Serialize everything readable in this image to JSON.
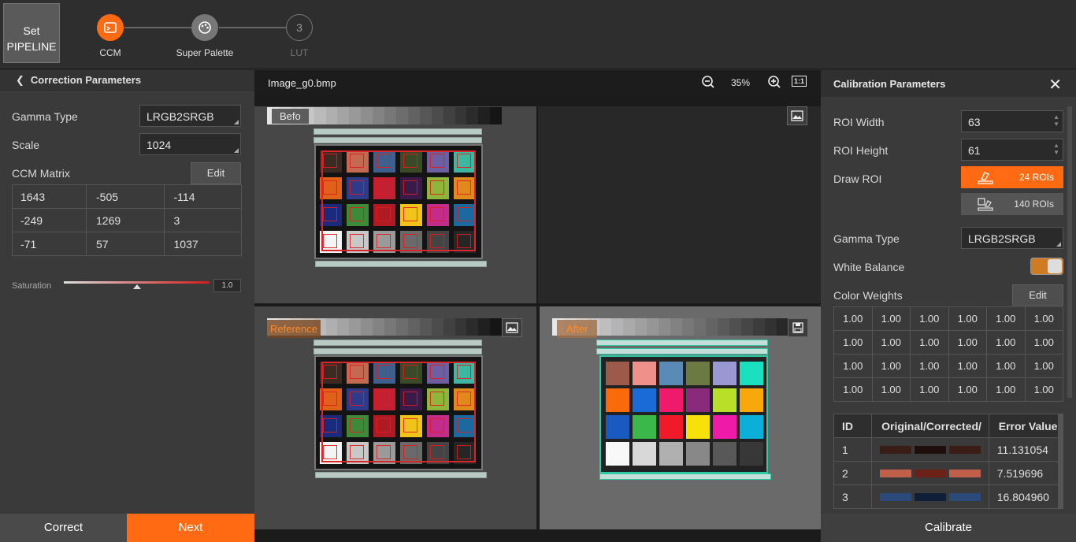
{
  "topbar": {
    "set_pipeline": "Set PIPELINE",
    "steps": [
      {
        "label": "CCM",
        "num": ""
      },
      {
        "label": "Super Palette",
        "num": ""
      },
      {
        "label": "LUT",
        "num": "3"
      }
    ]
  },
  "left": {
    "title": "Correction Parameters",
    "gamma_label": "Gamma Type",
    "gamma_value": "LRGB2SRGB",
    "scale_label": "Scale",
    "scale_value": "1024",
    "ccm_label": "CCM Matrix",
    "edit_label": "Edit",
    "ccm": [
      [
        "1643",
        "-505",
        "-114"
      ],
      [
        "-249",
        "1269",
        "3"
      ],
      [
        "-71",
        "57",
        "1037"
      ]
    ],
    "saturation_label": "Saturation",
    "saturation_value": "1.0",
    "saturation_level": 0.5,
    "correct_label": "Correct",
    "next_label": "Next"
  },
  "image": {
    "filename": "Image_g0.bmp",
    "zoom": "35%",
    "one_to_one": "1:1",
    "before_label": "Befo",
    "reference_label": "Reference",
    "after_label": "After"
  },
  "right": {
    "title": "Calibration Parameters",
    "roi_width_label": "ROI Width",
    "roi_width": "63",
    "roi_height_label": "ROI Height",
    "roi_height": "61",
    "draw_roi_label": "Draw ROI",
    "roi24": "24 ROIs",
    "roi140": "140 ROIs",
    "gamma_label": "Gamma Type",
    "gamma_value": "LRGB2SRGB",
    "wb_label": "White Balance",
    "weights_label": "Color Weights",
    "edit_label": "Edit",
    "weights": [
      [
        "1.00",
        "1.00",
        "1.00",
        "1.00",
        "1.00",
        "1.00"
      ],
      [
        "1.00",
        "1.00",
        "1.00",
        "1.00",
        "1.00",
        "1.00"
      ],
      [
        "1.00",
        "1.00",
        "1.00",
        "1.00",
        "1.00",
        "1.00"
      ],
      [
        "1.00",
        "1.00",
        "1.00",
        "1.00",
        "1.00",
        "1.00"
      ]
    ],
    "result_headers": [
      "ID",
      "Original/Corrected/",
      "Error Value"
    ],
    "results": [
      {
        "id": "1",
        "colors": [
          "#3a1d17",
          "#1e0e0c",
          "#3a1d17"
        ],
        "error": "11.131054"
      },
      {
        "id": "2",
        "colors": [
          "#c0604a",
          "#6b2118",
          "#c0604a"
        ],
        "error": "7.519696"
      },
      {
        "id": "3",
        "colors": [
          "#2b4a7a",
          "#0f1f38",
          "#2b4a7a"
        ],
        "error": "16.804960"
      }
    ],
    "calibrate_label": "Calibrate"
  },
  "colors": {
    "accent": "#ff6a13",
    "before_swatches": [
      "#3d2a22",
      "#c46a52",
      "#3f5f8c",
      "#3a4a26",
      "#6e5fa0",
      "#3fb7a0",
      "#e0621a",
      "#2e3a8a",
      "#c42034",
      "#3a1a48",
      "#8fb63a",
      "#e08a1e",
      "#1b2a7a",
      "#3c8a3a",
      "#b01a22",
      "#f0c41a",
      "#c42c8a",
      "#1a6aa0",
      "#f4f4f4",
      "#c8c8c8",
      "#9a9a9a",
      "#6a6a6a",
      "#444444",
      "#262626"
    ],
    "after_swatches": [
      "#9c5a4a",
      "#f0908a",
      "#5a8ab6",
      "#6a7a42",
      "#9a98d2",
      "#1ae0c0",
      "#f86a0a",
      "#1a6ad8",
      "#f01a6a",
      "#8a2a7a",
      "#b8e02a",
      "#f8a80a",
      "#1a5ac0",
      "#3ab84a",
      "#f01a2a",
      "#f8e00a",
      "#f01aa8",
      "#0ab0d8",
      "#f8f8f8",
      "#d8d8d8",
      "#b0b0b0",
      "#888888",
      "#585858",
      "#383838"
    ]
  }
}
